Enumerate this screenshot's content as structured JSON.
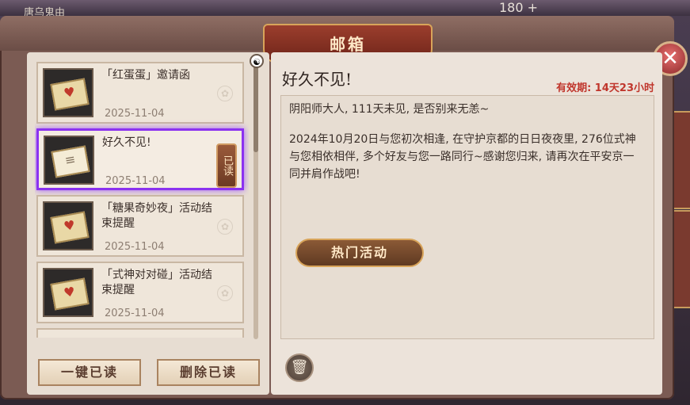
{
  "background": {
    "top_text": "唐乌鬼由",
    "currency": "180 +"
  },
  "mailbox": {
    "title": "邮箱",
    "close_symbol": "✕",
    "scroll_top_symbol": "☯",
    "mails": [
      {
        "title": "「红蛋蛋」邀请函",
        "date": "2025-11-04",
        "envelope": "♥",
        "decor": "✿"
      },
      {
        "title": "好久不见!",
        "date": "2025-11-04",
        "envelope": "≡",
        "read_tag": "已读"
      },
      {
        "title": "「糖果奇妙夜」活动结束提醒",
        "date": "2025-11-04",
        "envelope": "♥",
        "decor": "✿"
      },
      {
        "title": "「式神对对碰」活动结束提醒",
        "date": "2025-11-04",
        "envelope": "♥",
        "decor": "✿"
      }
    ],
    "mark_all_read": "一键已读",
    "delete_read": "删除已读",
    "detail": {
      "subject": "好久不见!",
      "validity": "有效期: 14天23小时",
      "greeting": "阴阳师大人, 111天未见, 是否别来无恙~",
      "paragraph": "2024年10月20日与您初次相逢, 在守护京都的日日夜夜里, 276位式神与您相依相伴, 多个好友与您一路同行~感谢您归来, 请再次在平安京一同并肩作战吧!",
      "activity_button": "热门活动",
      "trash_icon": "🗑"
    }
  }
}
